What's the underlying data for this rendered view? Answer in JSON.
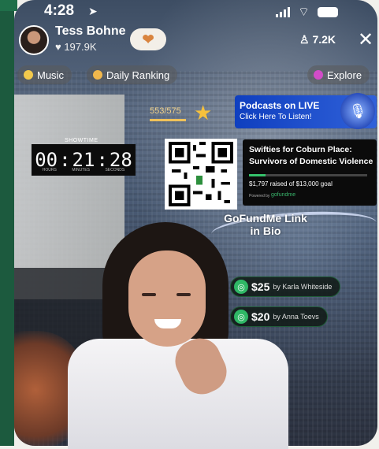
{
  "status_bar": {
    "time": "4:28"
  },
  "streamer": {
    "name": "Tess Bohne",
    "likes": "♥ 197.9K"
  },
  "viewers": "7.2K",
  "pills": [
    {
      "label": "Music",
      "icon": "music-icon",
      "color": "#f2c94c"
    },
    {
      "label": "Daily Ranking",
      "icon": "ranking-icon",
      "color": "#f2b84c"
    },
    {
      "label": "Explore",
      "icon": "explore-icon",
      "color": "#d24cc8"
    }
  ],
  "goal": {
    "text": "553/575",
    "progress": 0.96
  },
  "podcast": {
    "line1": "Podcasts on LIVE",
    "line2": "Click Here To Listen!"
  },
  "timer": {
    "label": "SHOWTIME",
    "hours": "00",
    "minutes": "21",
    "seconds": "28",
    "sub_hours": "HOURS",
    "sub_minutes": "MINUTES",
    "sub_seconds": "SECONDS"
  },
  "fundraiser": {
    "title": "Swifties for Coburn Place: Survivors of Domestic Violence",
    "raised": "$1,797 raised of $13,000 goal",
    "powered": "Powered by",
    "brand": "gofundme",
    "progress": 0.14,
    "link_text": "GoFundMe Link in Bio"
  },
  "donations": [
    {
      "amount": "$25",
      "by": "by Karla Whiteside"
    },
    {
      "amount": "$20",
      "by": "by Anna Toevs"
    }
  ],
  "colors": {
    "accent_green": "#2fb866",
    "podcast_blue": "#0f3fbf",
    "gold": "#f7c13c"
  }
}
